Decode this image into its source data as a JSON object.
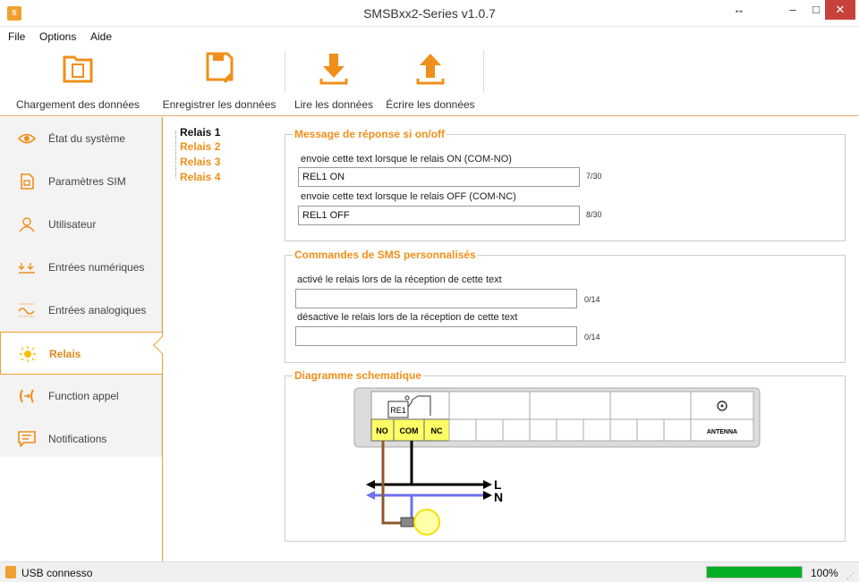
{
  "window": {
    "title": "SMSBxx2-Series v1.0.7",
    "resize_glyph": "↔",
    "minimize_glyph": "–",
    "maximize_glyph": "□",
    "close_glyph": "✕",
    "accent": "#f08f1a",
    "close_color": "#c7423b"
  },
  "menu": {
    "items": [
      "File",
      "Options",
      "Aide"
    ]
  },
  "toolbar": {
    "load_label": "Chargement des données",
    "save_label": "Enregistrer les données",
    "read_label": "Lire les données",
    "write_label": "Écrire les données"
  },
  "sidebar": {
    "items": [
      {
        "label": "État du système",
        "icon": "eye-icon"
      },
      {
        "label": "Paramètres SIM",
        "icon": "sim-card-icon"
      },
      {
        "label": "Utilisateur",
        "icon": "user-icon"
      },
      {
        "label": "Entrées numériques",
        "icon": "digital-input-icon"
      },
      {
        "label": "Entrées analogiques",
        "icon": "analog-input-icon"
      },
      {
        "label": "Relais",
        "icon": "bulb-icon"
      },
      {
        "label": "Function appel",
        "icon": "call-forward-icon"
      },
      {
        "label": "Notifications",
        "icon": "message-icon"
      }
    ],
    "active": "Relais"
  },
  "tree": {
    "items": [
      "Relais 1",
      "Relais 2",
      "Relais 3",
      "Relais 4"
    ],
    "selected": "Relais 1"
  },
  "response": {
    "title": "Message de réponse si on/off",
    "on_label": "envoie cette text lorsque le relais ON (COM-NO)",
    "on_value": "REL1 ON",
    "on_count": "7/30",
    "off_label": "envoie cette text lorsque le relais OFF (COM-NC)",
    "off_value": "REL1 OFF",
    "off_count": "8/30"
  },
  "commands": {
    "title": "Commandes de SMS personnalisés",
    "activate_label": "activé le relais lors de la réception de cette text",
    "activate_value": "",
    "activate_count": "0/14",
    "deactivate_label": "désactive le relais lors de la réception de cette text",
    "deactivate_value": "",
    "deactivate_count": "0/14"
  },
  "diagram": {
    "title": "Diagramme schematique",
    "relay_label": "RE1",
    "terminals": [
      "NO",
      "COM",
      "NC"
    ],
    "antenna_label": "ANTENNA",
    "line_l": "L",
    "line_n": "N"
  },
  "status": {
    "text": "USB connesso",
    "progress_label": "100%",
    "progress": 1.0
  }
}
